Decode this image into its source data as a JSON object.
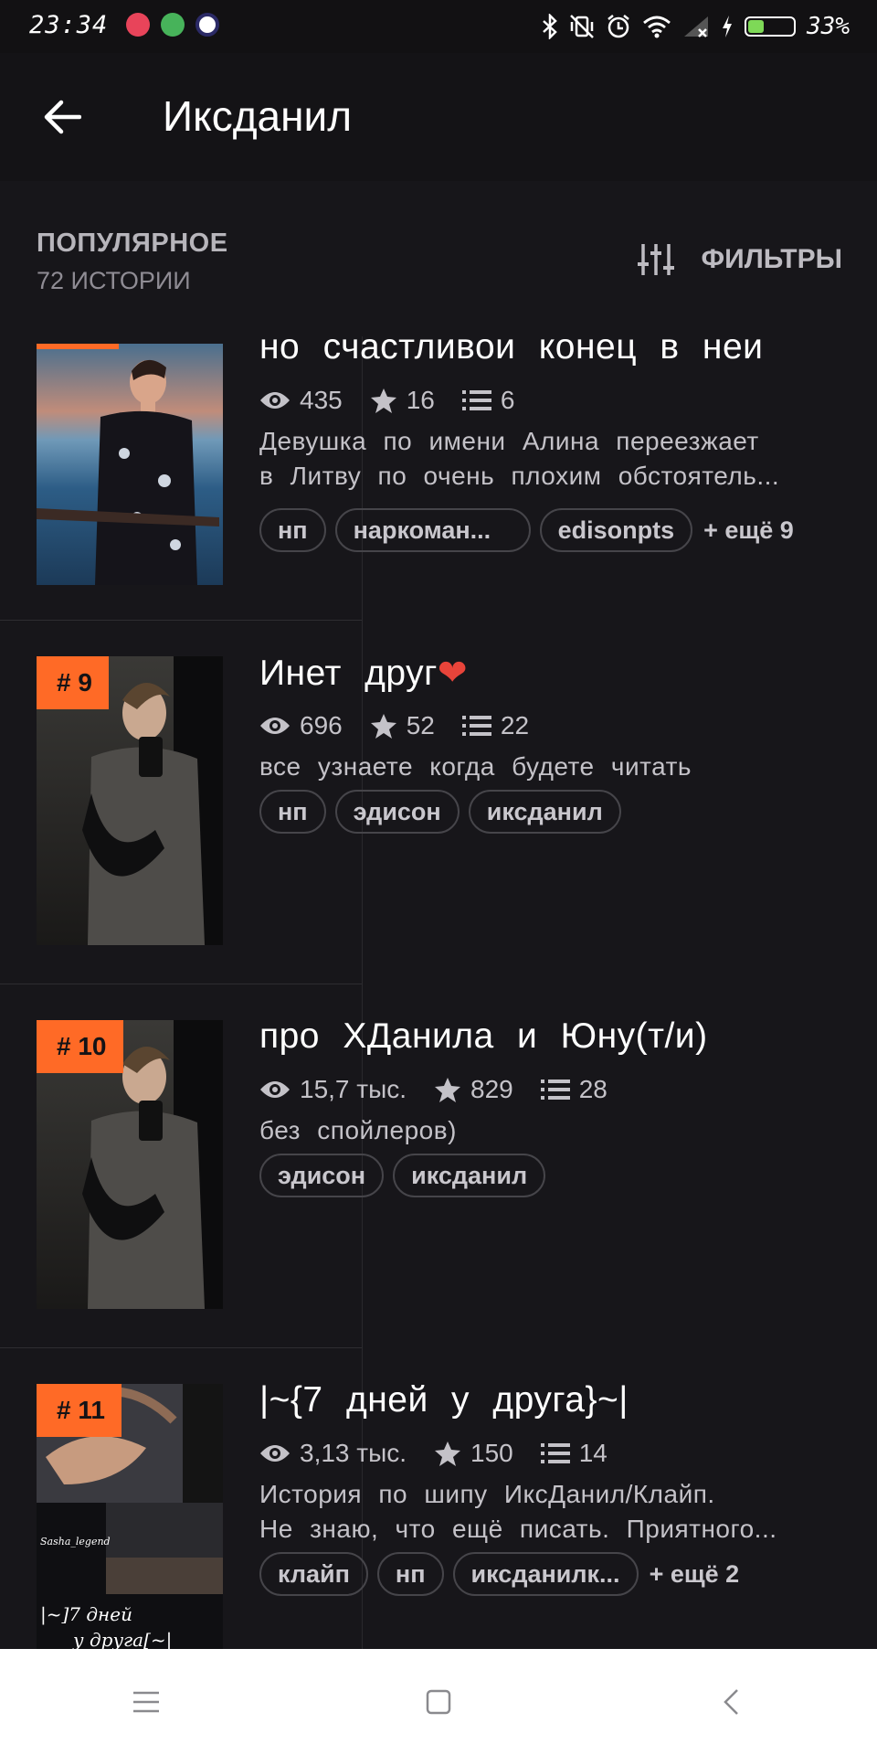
{
  "status_bar": {
    "time": "23:34",
    "battery_percent": "33%",
    "battery_level": 0.33,
    "icons": [
      "bluetooth-icon",
      "vibrate-off-icon",
      "alarm-icon",
      "wifi-icon",
      "signal-icon",
      "charging-icon",
      "battery-icon"
    ],
    "notification_icons": [
      "heart-app-icon",
      "android-app-icon",
      "r-app-icon"
    ]
  },
  "app_bar": {
    "title": "Иксданил"
  },
  "section": {
    "sort_label": "ПОПУЛЯРНОЕ",
    "count_label": "72 ИСТОРИИ",
    "filter_label": "ФИЛЬТРЫ"
  },
  "stories": [
    {
      "rank": "",
      "title": "но счастливои конец в неи",
      "views": "435",
      "stars": "16",
      "parts": "6",
      "description": [
        "Девушка по имени Алина переезжает",
        "в Литву по очень плохим обстоятель..."
      ],
      "tags": [
        "нп",
        "наркоман...",
        "edisonpts"
      ],
      "more": "+ ещё 9"
    },
    {
      "rank": "# 9",
      "title": "Инет друг❤️",
      "views": "696",
      "stars": "52",
      "parts": "22",
      "description": [
        "все узнаете когда будете читать"
      ],
      "tags": [
        "нп",
        "эдисон",
        "иксданил"
      ],
      "more": ""
    },
    {
      "rank": "# 10",
      "title": "про ХДанила  и Юну(т/и)",
      "views": "15,7 тыс.",
      "stars": "829",
      "parts": "28",
      "description": [
        "без спойлеров)"
      ],
      "tags": [
        "эдисон",
        "иксданил"
      ],
      "more": ""
    },
    {
      "rank": "# 11",
      "title": "|~{7 дней у друга}~|",
      "views": "3,13 тыс.",
      "stars": "150",
      "parts": "14",
      "description": [
        "История по шипу ИксДанил/Клайп.",
        "Не знаю, что ещё писать. Приятного..."
      ],
      "tags": [
        "клайп",
        "нп",
        "иксданилк..."
      ],
      "more": "+ ещё 2",
      "cover_text": [
        "Sasha_legend",
        "|~]7 дней",
        "у друга[~|"
      ]
    }
  ],
  "colors": {
    "accent": "#ff6a26",
    "background": "#17161a",
    "heart": "#e8443a"
  }
}
